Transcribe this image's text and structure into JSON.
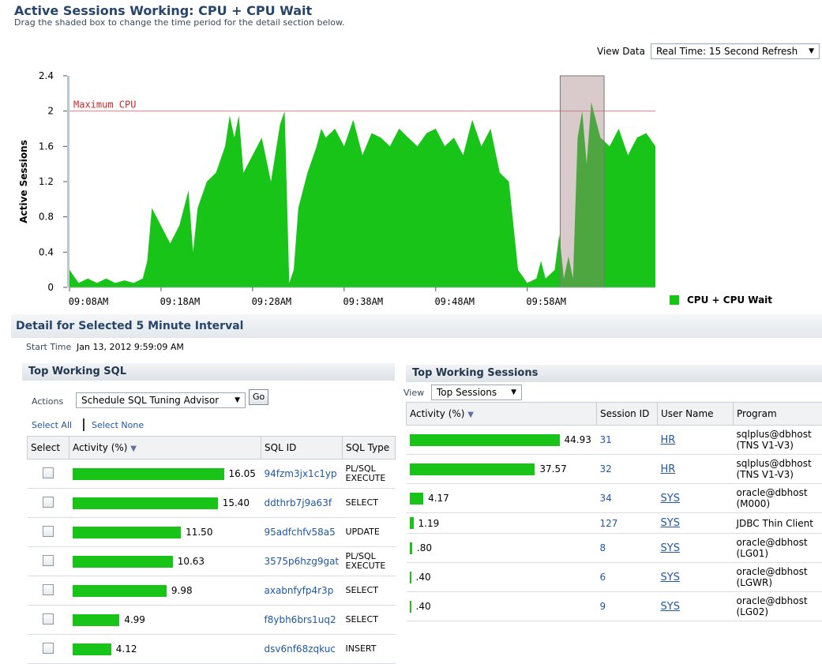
{
  "header": {
    "title": "Active Sessions Working: CPU + CPU Wait",
    "subtitle": "Drag the shaded box to change the time period for the detail section below.",
    "view_data_label": "View Data",
    "view_data_value": "Real Time: 15 Second Refresh"
  },
  "chart_data": {
    "type": "area",
    "ylabel": "Active Sessions",
    "ylim": [
      0,
      2.4
    ],
    "y_ticks": [
      "0",
      "0.4",
      "0.8",
      "1.2",
      "1.6",
      "2",
      "2.4"
    ],
    "x_ticks": [
      "09:08AM",
      "09:18AM",
      "09:28AM",
      "09:38AM",
      "09:48AM",
      "09:58AM"
    ],
    "max_cpu_label": "Maximum CPU",
    "max_cpu_value": 2,
    "series": [
      {
        "name": "CPU + CPU Wait",
        "color": "#18c418"
      }
    ],
    "x_minutes": [
      0,
      1,
      2,
      3,
      4,
      5,
      6,
      7,
      8,
      8.5,
      9,
      10,
      11,
      12,
      13,
      13.5,
      14,
      15,
      16,
      17,
      17.5,
      18,
      18.5,
      19,
      20,
      21,
      22,
      23,
      23.5,
      24,
      24.5,
      25,
      26,
      27,
      27.5,
      28,
      29,
      30,
      31,
      32,
      33,
      34,
      35,
      36,
      37,
      38,
      39,
      40,
      41,
      42,
      43,
      44,
      45,
      46,
      47,
      48,
      49,
      50,
      51,
      51.5,
      52,
      53,
      53.5,
      54,
      54.5,
      55,
      55.5,
      56,
      56.5,
      57,
      58,
      59,
      60,
      61,
      62,
      63,
      64
    ],
    "values": [
      0.2,
      0.05,
      0.1,
      0.05,
      0.1,
      0.05,
      0.08,
      0.05,
      0.1,
      0.3,
      0.9,
      0.7,
      0.5,
      0.7,
      1.1,
      0.4,
      0.9,
      1.2,
      1.3,
      1.6,
      1.95,
      1.7,
      1.95,
      1.3,
      1.5,
      1.7,
      1.2,
      1.85,
      2.0,
      0.05,
      0.2,
      0.9,
      1.3,
      1.6,
      1.8,
      1.7,
      1.8,
      1.6,
      1.9,
      1.5,
      1.75,
      1.7,
      1.6,
      1.8,
      1.7,
      1.6,
      1.75,
      1.8,
      1.6,
      1.7,
      1.5,
      1.9,
      1.6,
      1.8,
      1.3,
      1.2,
      0.2,
      0.05,
      0.1,
      0.3,
      0.1,
      0.2,
      0.6,
      0.1,
      0.35,
      0.1,
      1.7,
      2.0,
      1.4,
      2.1,
      1.7,
      1.6,
      1.8,
      1.5,
      1.7,
      1.75,
      1.6
    ],
    "selected_range_minutes": [
      53.6,
      58.4
    ],
    "selection_color": "#d9c8ca"
  },
  "detail": {
    "title": "Detail for Selected 5 Minute Interval",
    "start_time_label": "Start Time",
    "start_time_value": "Jan 13, 2012 9:59:09 AM"
  },
  "top_sql": {
    "title": "Top Working SQL",
    "actions_label": "Actions",
    "actions_value": "Schedule SQL Tuning Advisor",
    "go_label": "Go",
    "select_all": "Select All",
    "select_none": "Select None",
    "columns": [
      "Select",
      "Activity (%)",
      "SQL ID",
      "SQL Type"
    ],
    "rows": [
      {
        "activity": 16.05,
        "activity_text": "16.05",
        "sql_id": "94fzm3jx1c1yp",
        "sql_type": "PL/SQL EXECUTE"
      },
      {
        "activity": 15.4,
        "activity_text": "15.40",
        "sql_id": "ddthrb7j9a63f",
        "sql_type": "SELECT"
      },
      {
        "activity": 11.5,
        "activity_text": "11.50",
        "sql_id": "95adfchfv58a5",
        "sql_type": "UPDATE"
      },
      {
        "activity": 10.63,
        "activity_text": "10.63",
        "sql_id": "3575p6hzg9gat",
        "sql_type": "PL/SQL EXECUTE"
      },
      {
        "activity": 9.98,
        "activity_text": "9.98",
        "sql_id": "axabnfyfp4r3p",
        "sql_type": "SELECT"
      },
      {
        "activity": 4.99,
        "activity_text": "4.99",
        "sql_id": "f8ybh6brs1uq2",
        "sql_type": "SELECT"
      },
      {
        "activity": 4.12,
        "activity_text": "4.12",
        "sql_id": "dsv6nf68zqkuc",
        "sql_type": "INSERT"
      }
    ]
  },
  "top_sessions": {
    "title": "Top Working Sessions",
    "view_label": "View",
    "view_value": "Top Sessions",
    "columns": [
      "Activity (%)",
      "Session ID",
      "User Name",
      "Program"
    ],
    "rows": [
      {
        "activity": 44.93,
        "activity_text": "44.93",
        "session_id": "31",
        "user": "HR",
        "program": "sqlplus@dbhost (TNS V1-V3)"
      },
      {
        "activity": 37.57,
        "activity_text": "37.57",
        "session_id": "32",
        "user": "HR",
        "program": "sqlplus@dbhost (TNS V1-V3)"
      },
      {
        "activity": 4.17,
        "activity_text": "4.17",
        "session_id": "34",
        "user": "SYS",
        "program": "oracle@dbhost (M000)"
      },
      {
        "activity": 1.19,
        "activity_text": "1.19",
        "session_id": "127",
        "user": "SYS",
        "program": "JDBC Thin Client"
      },
      {
        "activity": 0.8,
        "activity_text": ".80",
        "session_id": "8",
        "user": "SYS",
        "program": "oracle@dbhost (LG01)"
      },
      {
        "activity": 0.4,
        "activity_text": ".40",
        "session_id": "6",
        "user": "SYS",
        "program": "oracle@dbhost (LGWR)"
      },
      {
        "activity": 0.4,
        "activity_text": ".40",
        "session_id": "9",
        "user": "SYS",
        "program": "oracle@dbhost (LG02)"
      }
    ]
  }
}
